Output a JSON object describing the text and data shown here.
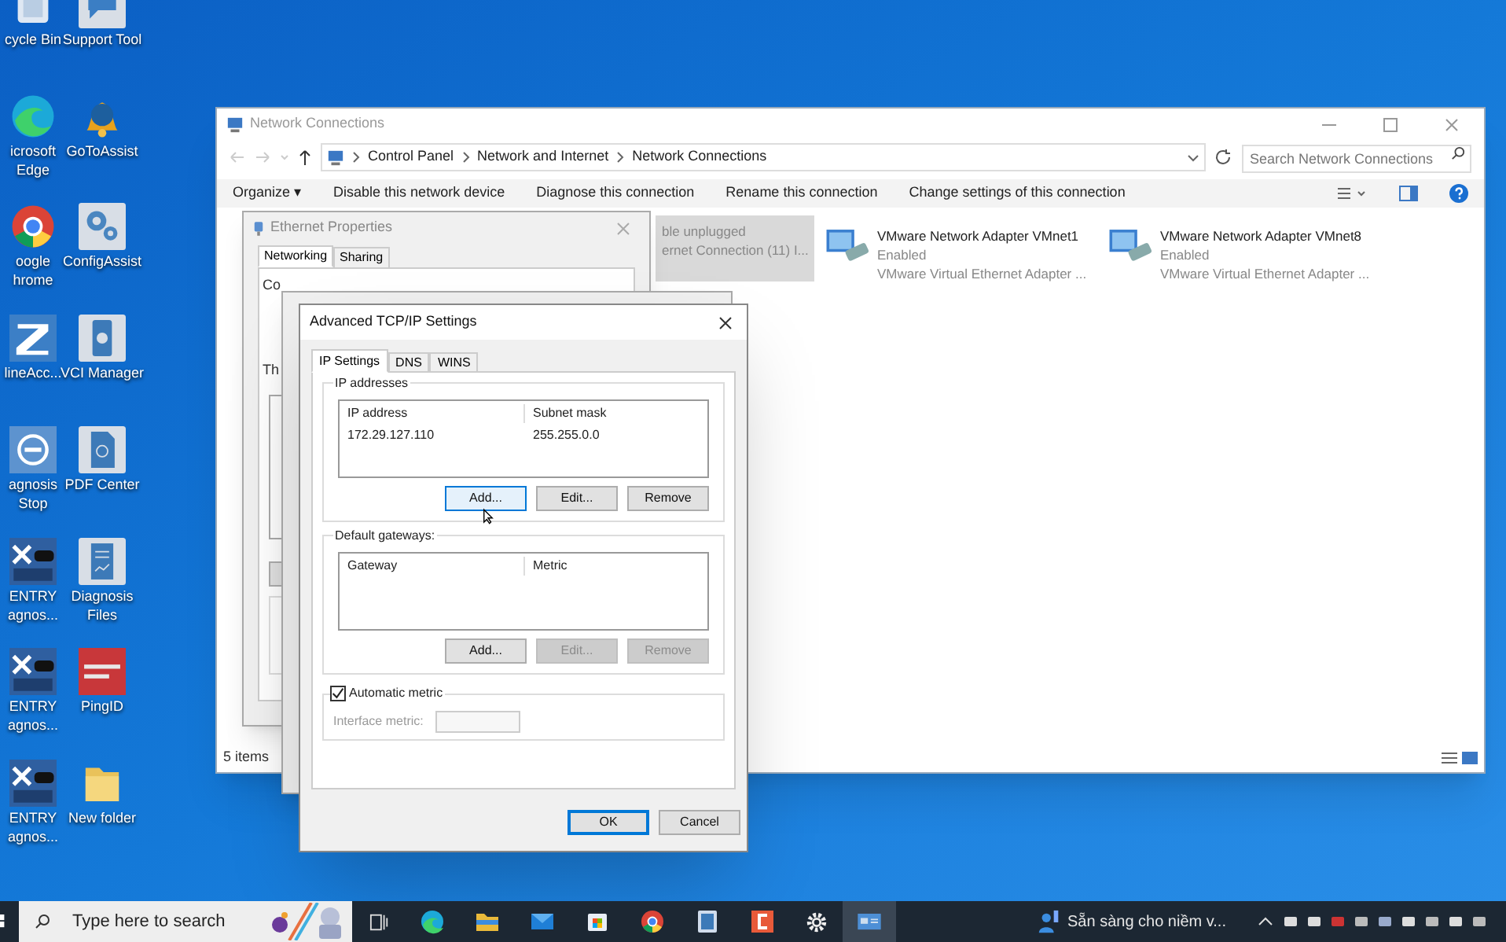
{
  "desktop": {
    "icons_left": [
      {
        "label": "cycle Bin"
      },
      {
        "label": "icrosoft Edge"
      },
      {
        "label": "oogle hrome"
      },
      {
        "label": "lineAcc..."
      },
      {
        "label": "agnosis Stop"
      },
      {
        "label": "ENTRY agnos..."
      },
      {
        "label": "ENTRY agnos..."
      },
      {
        "label": "ENTRY agnos..."
      }
    ],
    "icons_right": [
      {
        "label": "Support Tool"
      },
      {
        "label": "GoToAssist"
      },
      {
        "label": "ConfigAssist"
      },
      {
        "label": "VCI Manager"
      },
      {
        "label": "PDF Center"
      },
      {
        "label": "Diagnosis Files"
      },
      {
        "label": "PingID"
      },
      {
        "label": "New folder"
      }
    ]
  },
  "network_window": {
    "title": "Network Connections",
    "breadcrumb": [
      "Control Panel",
      "Network and Internet",
      "Network Connections"
    ],
    "search": {
      "placeholder": "Search Network Connections"
    },
    "commands": [
      "Organize ▾",
      "Disable this network device",
      "Diagnose this connection",
      "Rename this connection",
      "Change settings of this connection"
    ],
    "adapters": [
      {
        "status": "ble unplugged",
        "device": "ernet Connection (11) I...",
        "selected": true
      },
      {
        "name": "VMware Network Adapter VMnet1",
        "status": "Enabled",
        "device": "VMware Virtual Ethernet Adapter ...",
        "selected": false
      },
      {
        "name": "VMware Network Adapter VMnet8",
        "status": "Enabled",
        "device": "VMware Virtual Ethernet Adapter ...",
        "selected": false
      }
    ],
    "status_bar": "5 items"
  },
  "ethernet_properties": {
    "title": "Ethernet Properties",
    "tabs": [
      {
        "label": "Networking",
        "selected": true
      },
      {
        "label": "Sharing",
        "selected": false
      }
    ],
    "labels": [
      "Co",
      "Th"
    ]
  },
  "advanced_dialog": {
    "title": "Advanced TCP/IP Settings",
    "tabs": [
      {
        "label": "IP Settings",
        "selected": true
      },
      {
        "label": "DNS",
        "selected": false
      },
      {
        "label": "WINS",
        "selected": false
      }
    ],
    "ip_addresses": {
      "legend": "IP addresses",
      "columns": [
        "IP address",
        "Subnet mask"
      ],
      "rows": [
        [
          "172.29.127.110",
          "255.255.0.0"
        ]
      ],
      "buttons": [
        {
          "label": "Add...",
          "disabled": false,
          "hovered": true
        },
        {
          "label": "Edit...",
          "disabled": false,
          "hovered": false
        },
        {
          "label": "Remove",
          "disabled": false,
          "hovered": false
        }
      ]
    },
    "gateways": {
      "legend": "Default gateways:",
      "columns": [
        "Gateway",
        "Metric"
      ],
      "buttons": [
        {
          "label": "Add...",
          "disabled": false,
          "hovered": false
        },
        {
          "label": "Edit...",
          "disabled": true,
          "hovered": false
        },
        {
          "label": "Remove",
          "disabled": true,
          "hovered": false
        }
      ]
    },
    "automatic_metric": {
      "label": "Automatic metric",
      "checked": true
    },
    "interface_metric": {
      "label": "Interface metric:",
      "disabled": true
    },
    "buttons": [
      {
        "label": "OK",
        "default": true
      },
      {
        "label": "Cancel",
        "default": false
      }
    ]
  },
  "taskbar": {
    "search": {
      "placeholder": "Type here to search"
    },
    "notification": "Sẵn sàng cho niềm v..."
  }
}
